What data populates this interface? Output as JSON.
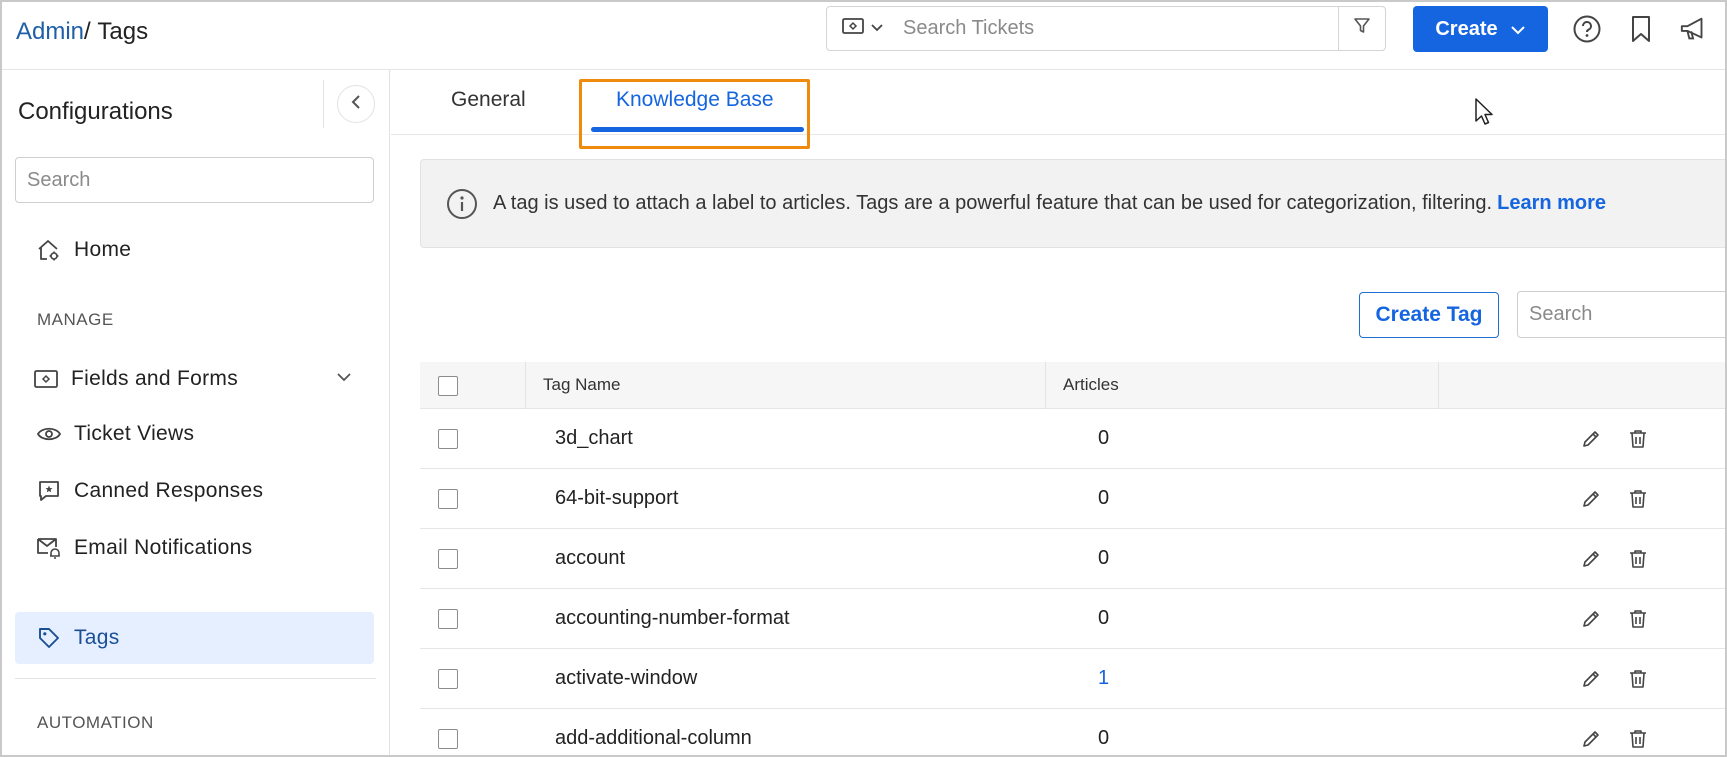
{
  "breadcrumb": {
    "parent": "Admin",
    "separator": "/ ",
    "current": "Tags"
  },
  "header": {
    "search_placeholder": "Search Tickets",
    "ticket_type_icon": "ticket-icon",
    "create_label": "Create",
    "icons": [
      "help-icon",
      "bookmark-icon",
      "announcement-icon"
    ]
  },
  "sidebar": {
    "title": "Configurations",
    "search_placeholder": "Search",
    "home_label": "Home",
    "manage_label": "MANAGE",
    "items": [
      {
        "label": "Fields and Forms",
        "icon": "ticket-icon"
      },
      {
        "label": "Ticket Views",
        "icon": "eye-icon"
      },
      {
        "label": "Canned Responses",
        "icon": "chat-icon"
      },
      {
        "label": "Email Notifications",
        "icon": "email-bell-icon"
      },
      {
        "label": "Tags",
        "icon": "tag-icon"
      }
    ],
    "automation_label": "AUTOMATION"
  },
  "tabs": [
    {
      "label": "General"
    },
    {
      "label": "Knowledge Base"
    }
  ],
  "banner": {
    "text": "A tag is used to attach a label to articles. Tags are a powerful feature that can be used for categorization, filtering.",
    "link": "Learn more"
  },
  "toolbar": {
    "create_tag_label": "Create Tag",
    "search_placeholder": "Search"
  },
  "table": {
    "columns": [
      "Tag Name",
      "Articles"
    ],
    "rows": [
      {
        "name": "3d_chart",
        "articles": "0"
      },
      {
        "name": "64-bit-support",
        "articles": "0"
      },
      {
        "name": "account",
        "articles": "0"
      },
      {
        "name": "accounting-number-format",
        "articles": "0"
      },
      {
        "name": "activate-window",
        "articles": "1"
      },
      {
        "name": "add-additional-column",
        "articles": "0"
      }
    ]
  },
  "colors": {
    "accent": "#1565e0",
    "highlight": "#f08a0c",
    "active_nav_bg": "#e5efff"
  }
}
